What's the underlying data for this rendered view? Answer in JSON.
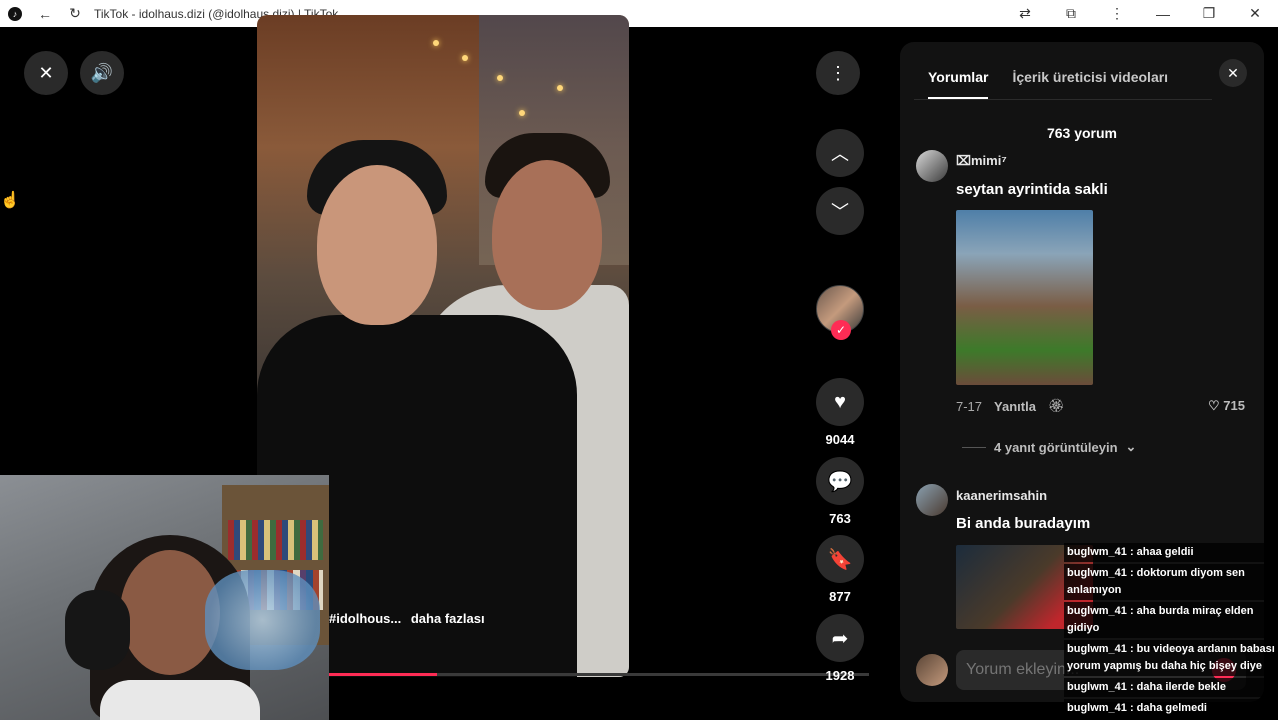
{
  "window": {
    "title": "TikTok - idolhaus.dizi (@idolhaus.dizi) | TikTok",
    "favicon": "tiktok-icon"
  },
  "player": {
    "caption_hashtag": "#idolhous...",
    "caption_more": "daha fazlası",
    "progress_fraction": 0.2
  },
  "actions": {
    "likes": "9044",
    "comments": "763",
    "saves": "877",
    "shares": "1928"
  },
  "panel": {
    "tabs": [
      "Yorumlar",
      "İçerik üreticisi videoları"
    ],
    "comment_count": "763 yorum",
    "comments": [
      {
        "user": "⌧mimi⁷",
        "text": "seytan ayrintida sakli",
        "date": "7-17",
        "reply": "Yanıtla",
        "likes": "715",
        "view_replies": "4 yanıt görüntüleyin"
      },
      {
        "user": "kaanerimsahin",
        "text": "Bi anda buradayım"
      }
    ],
    "add_placeholder": "Yorum ekleyin..."
  },
  "chat": [
    "buglwm_41 : ahaa geldii",
    "buglwm_41 : doktorum diyom sen anlamıyon",
    "buglwm_41 : aha burda miraç elden gidiyo",
    "buglwm_41 : bu videoya ardanın babası yorum yapmış bu daha hiç bişey diye",
    "buglwm_41 : daha ilerde bekle",
    "buglwm_41 : daha gelmedi"
  ],
  "colors": {
    "accent": "#fe2c55",
    "panel_bg": "#121212",
    "button_bg": "#2a2a2a"
  }
}
